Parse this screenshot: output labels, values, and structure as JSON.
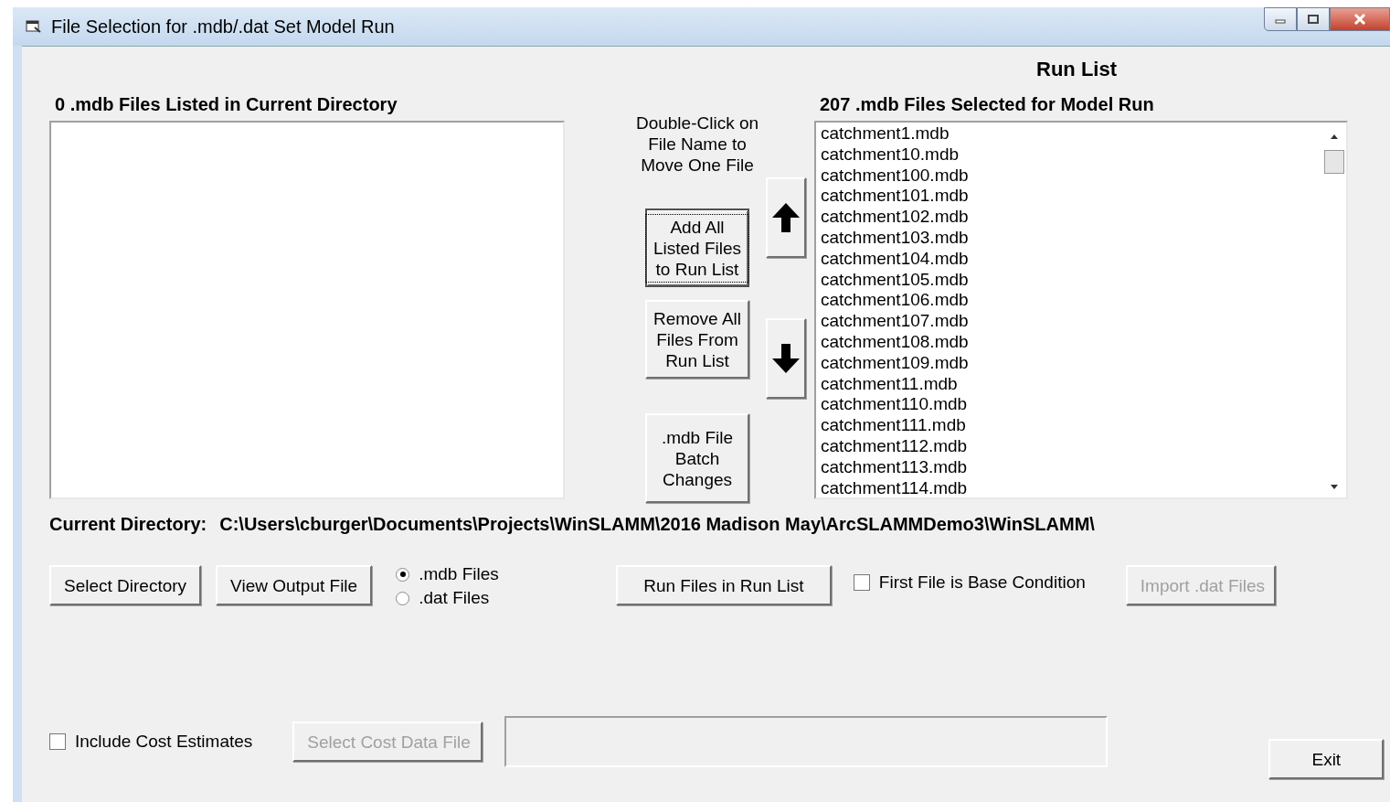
{
  "window": {
    "title": "File Selection for .mdb/.dat Set Model Run"
  },
  "left_list": {
    "heading": "0 .mdb Files Listed in Current Directory"
  },
  "instructions": "Double-Click on File Name to Move One File",
  "middle_buttons": [
    {
      "label": "Add All Listed Files to Run List",
      "focused": true
    },
    {
      "label": "Remove All Files From Run List",
      "focused": false
    },
    {
      "label": ".mdb File Batch Changes",
      "focused": false
    }
  ],
  "run_list": {
    "title": "Run List",
    "heading": "207 .mdb Files Selected for Model Run",
    "items": [
      "catchment1.mdb",
      "catchment10.mdb",
      "catchment100.mdb",
      "catchment101.mdb",
      "catchment102.mdb",
      "catchment103.mdb",
      "catchment104.mdb",
      "catchment105.mdb",
      "catchment106.mdb",
      "catchment107.mdb",
      "catchment108.mdb",
      "catchment109.mdb",
      "catchment11.mdb",
      "catchment110.mdb",
      "catchment111.mdb",
      "catchment112.mdb",
      "catchment113.mdb",
      "catchment114.mdb"
    ]
  },
  "current_directory": {
    "label": "Current Directory:",
    "path": "C:\\Users\\cburger\\Documents\\Projects\\WinSLAMM\\2016 Madison May\\ArcSLAMMDemo3\\WinSLAMM\\"
  },
  "controls_row": [
    {
      "kind": "button",
      "label": "Select Directory",
      "disabled": false
    },
    {
      "kind": "button",
      "label": "View Output File",
      "disabled": false
    },
    {
      "kind": "radios",
      "options": [
        {
          "label": ".mdb Files",
          "selected": true
        },
        {
          "label": ".dat Files",
          "selected": false
        }
      ]
    },
    {
      "kind": "button",
      "label": "Run Files in Run List",
      "disabled": false
    },
    {
      "kind": "checkbox",
      "label": "First File is Base Condition",
      "checked": false
    },
    {
      "kind": "button",
      "label": "Import .dat Files",
      "disabled": true
    }
  ],
  "cost_row": {
    "checkbox": {
      "label": "Include Cost Estimates",
      "checked": false
    },
    "button": {
      "label": "Select Cost Data File",
      "disabled": true
    }
  },
  "exit_button": "Exit"
}
